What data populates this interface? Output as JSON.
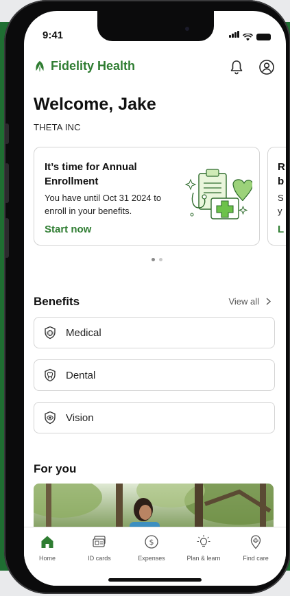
{
  "status_bar": {
    "time": "9:41"
  },
  "header": {
    "brand_name": "Fidelity Health",
    "icons": [
      "bell-icon",
      "profile-icon"
    ]
  },
  "welcome": {
    "title": "Welcome, Jake",
    "company": "THETA INC"
  },
  "cards": [
    {
      "title": "It’s time for Annual Enrollment",
      "body": "You have until Oct 31 2024 to enroll in your benefits.",
      "link": "Start now"
    },
    {
      "title": "R\nb",
      "body": "S\ny",
      "link": "L"
    }
  ],
  "benefits": {
    "title": "Benefits",
    "view_all": "View all",
    "items": [
      {
        "label": "Medical",
        "icon": "medical-shield-icon"
      },
      {
        "label": "Dental",
        "icon": "dental-shield-icon"
      },
      {
        "label": "Vision",
        "icon": "eye-shield-icon"
      }
    ]
  },
  "for_you": {
    "title": "For you"
  },
  "tabbar": {
    "items": [
      {
        "label": "Home",
        "icon": "home-icon",
        "active": true
      },
      {
        "label": "ID cards",
        "icon": "id-card-icon"
      },
      {
        "label": "Expenses",
        "icon": "dollar-icon"
      },
      {
        "label": "Plan & learn",
        "icon": "lightbulb-icon"
      },
      {
        "label": "Find care",
        "icon": "location-plus-icon"
      }
    ]
  },
  "colors": {
    "brand_green": "#2f7d32",
    "background_green": "#1f6e32"
  }
}
